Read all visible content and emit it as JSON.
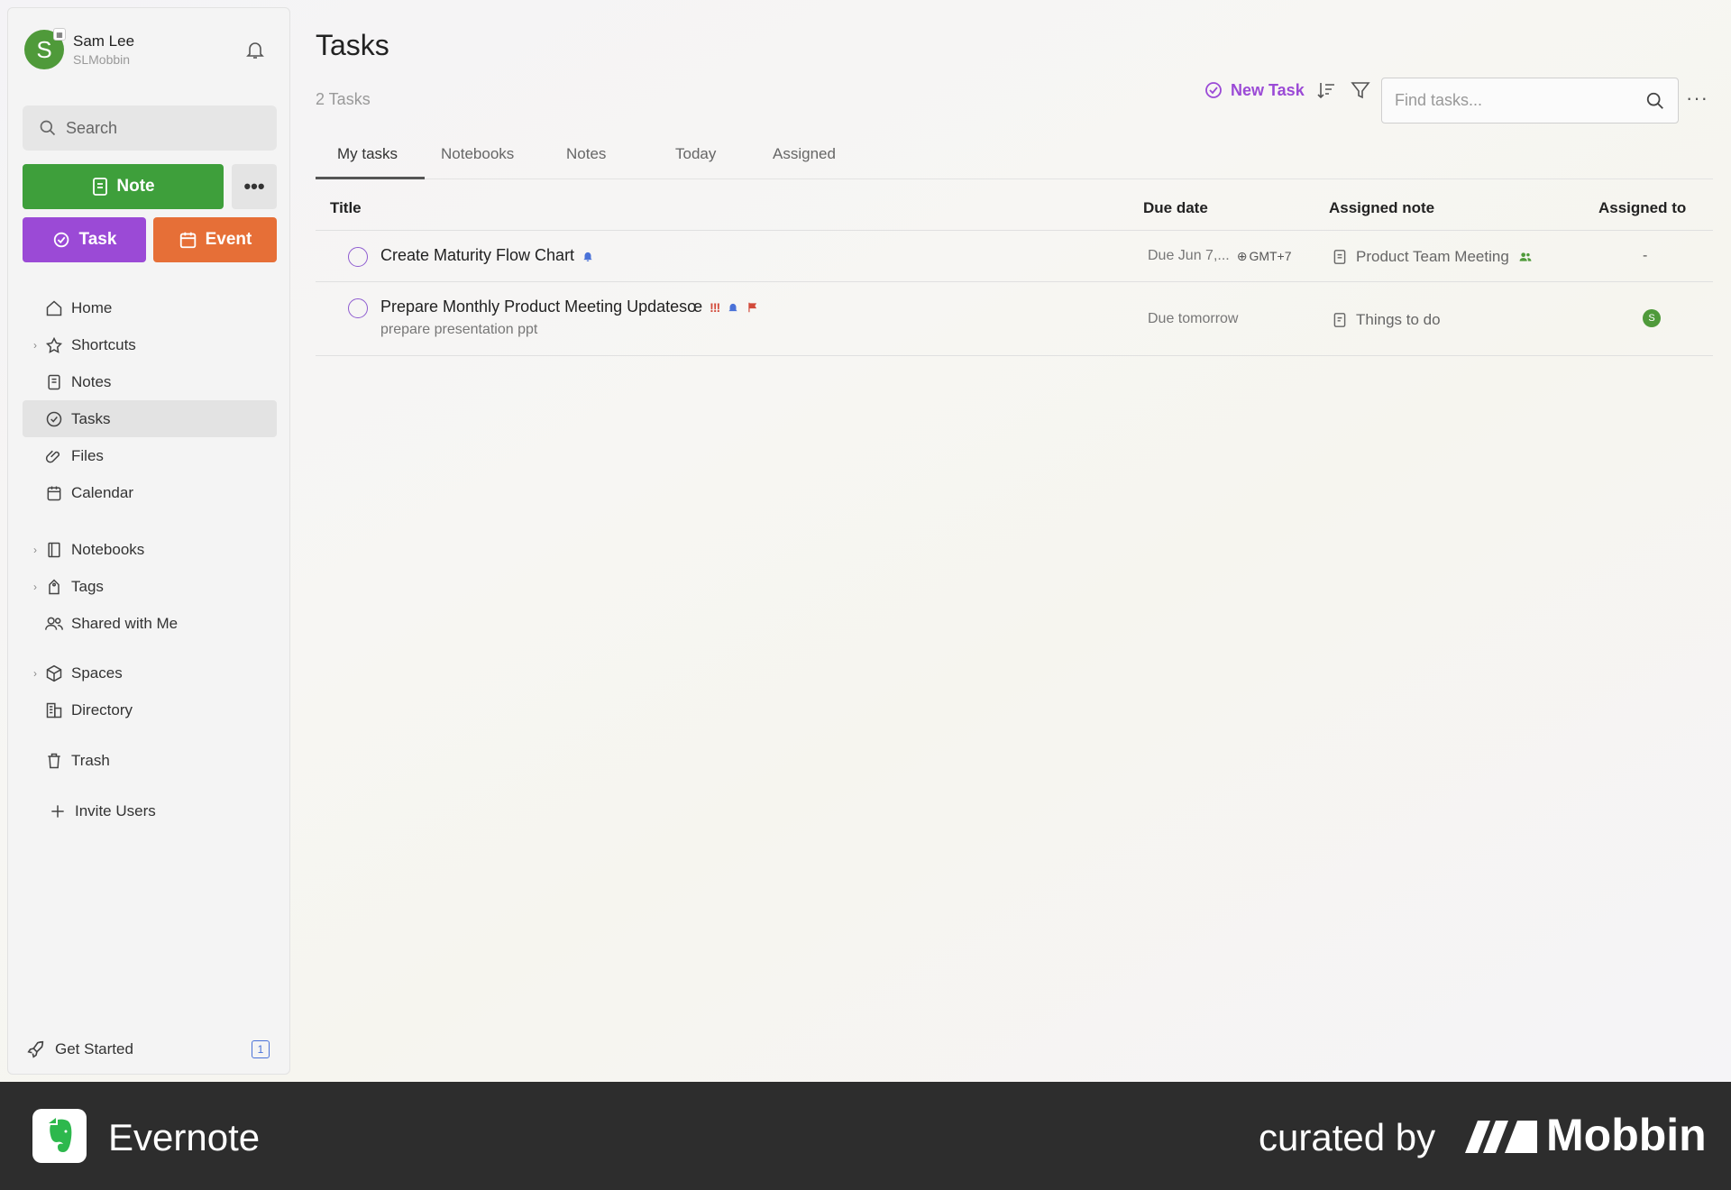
{
  "user": {
    "name": "Sam Lee",
    "handle": "SLMobbin",
    "initial": "S"
  },
  "sidebar": {
    "search_label": "Search",
    "note_button": "Note",
    "more_button": "•••",
    "task_button": "Task",
    "event_button": "Event",
    "items": [
      {
        "label": "Home",
        "icon": "home-icon"
      },
      {
        "label": "Shortcuts",
        "icon": "star-icon"
      },
      {
        "label": "Notes",
        "icon": "note-icon"
      },
      {
        "label": "Tasks",
        "icon": "check-circle-icon"
      },
      {
        "label": "Files",
        "icon": "paperclip-icon"
      },
      {
        "label": "Calendar",
        "icon": "calendar-icon"
      },
      {
        "label": "Notebooks",
        "icon": "notebook-icon"
      },
      {
        "label": "Tags",
        "icon": "tag-icon"
      },
      {
        "label": "Shared with Me",
        "icon": "users-icon"
      },
      {
        "label": "Spaces",
        "icon": "cube-icon"
      },
      {
        "label": "Directory",
        "icon": "building-icon"
      },
      {
        "label": "Trash",
        "icon": "trash-icon"
      },
      {
        "label": "Invite Users",
        "icon": "plus-icon"
      }
    ],
    "get_started": {
      "label": "Get Started",
      "badge": "1"
    }
  },
  "main": {
    "title": "Tasks",
    "count": "2 Tasks",
    "new_task": "New Task",
    "find_placeholder": "Find tasks...",
    "more": "···",
    "tabs": [
      "My tasks",
      "Notebooks",
      "Notes",
      "Today",
      "Assigned"
    ],
    "columns": {
      "title": "Title",
      "due": "Due date",
      "note": "Assigned note",
      "assignee": "Assigned to"
    },
    "rows": [
      {
        "title": "Create Maturity Flow Chart",
        "due": "Due Jun 7,...",
        "timezone": "GMT+7",
        "note": "Product Team Meeting",
        "assignee": "-"
      },
      {
        "title": "Prepare Monthly Product Meeting Updatesœ",
        "priority": "!!!",
        "subtitle": "prepare presentation ppt",
        "due": "Due tomorrow",
        "note": "Things to do",
        "assignee_initial": "S"
      }
    ]
  },
  "footer": {
    "brand": "Evernote",
    "curated": "curated by",
    "mobbin": "Mobbin"
  },
  "colors": {
    "green": "#3e9f3b",
    "purple": "#9b4ad6",
    "orange": "#e66f37",
    "footer": "#2d2d2d"
  }
}
